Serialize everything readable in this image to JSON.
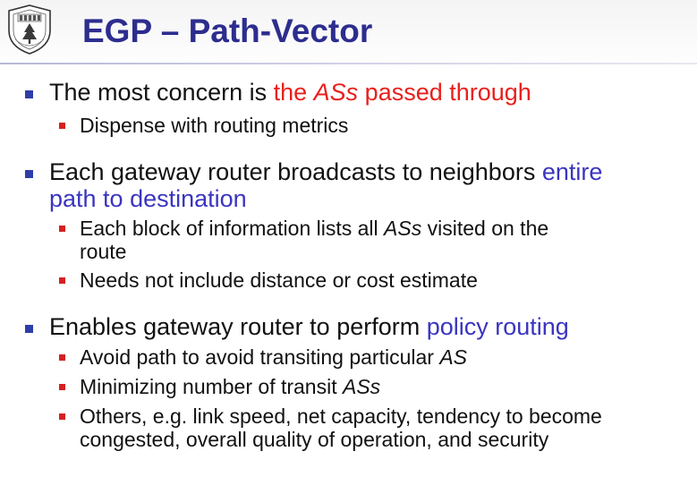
{
  "title": "EGP – Path-Vector",
  "logo": {
    "icon": "university-emblem-icon"
  },
  "bullets": [
    {
      "main": {
        "text": "The most concern is ",
        "highlight_a": "the ",
        "highlight_italic": "ASs",
        "highlight_b": " passed through"
      },
      "subs": [
        {
          "text": "Dispense with routing metrics"
        }
      ]
    },
    {
      "main": {
        "text": "Each gateway router broadcasts to neighbors ",
        "highlight_line1": "entire",
        "highlight_line2": "path to destination"
      },
      "subs": [
        {
          "pre": "Each block of information lists all ",
          "italic": "ASs",
          "post": " visited on the",
          "line2": "route"
        },
        {
          "text": "Needs not include distance or cost estimate"
        }
      ]
    },
    {
      "main": {
        "text": "Enables gateway router to perform ",
        "highlight": "policy routing"
      },
      "subs": [
        {
          "pre": "Avoid path to avoid transiting particular ",
          "italic": "AS"
        },
        {
          "pre": "Minimizing number of transit ",
          "italic": "ASs"
        },
        {
          "text": "Others, e.g. link speed, net capacity, tendency to become",
          "line2": "congested, overall quality of operation, and security"
        }
      ]
    }
  ],
  "colors": {
    "title": "#2d2d8f",
    "main_bullet": "#2f3ea8",
    "sub_bullet": "#d42020",
    "highlight_red": "#e8201c",
    "highlight_blue": "#3a35c0"
  }
}
